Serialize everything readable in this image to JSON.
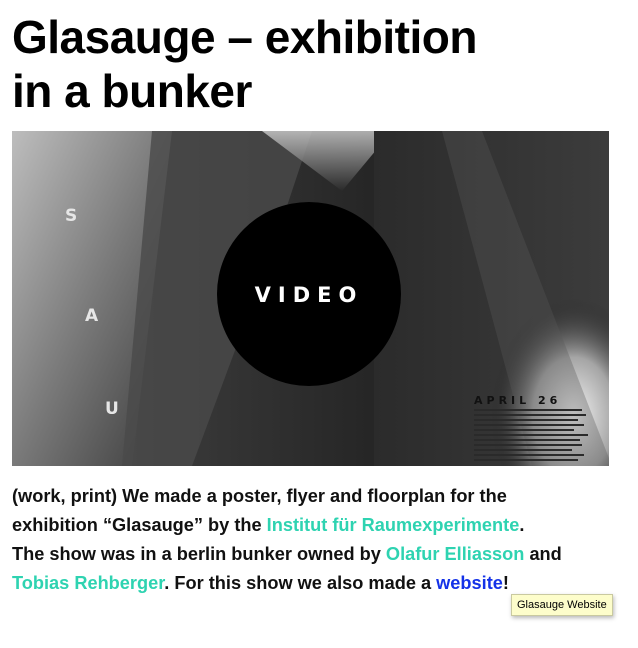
{
  "article": {
    "title_line1": "Glasauge – exhibition",
    "title_line2": "in a bunker"
  },
  "video": {
    "play_label": "VIDEO",
    "letters": [
      "S",
      "A",
      "U"
    ],
    "poster_date": "APRIL 26"
  },
  "description": {
    "part1": "(work, print) We made a poster, flyer and floorplan for the",
    "part2": "exhibition “Glasauge” by the ",
    "link_institute": "Institut für Raumexperimente",
    "part3": ".",
    "part4": "The show was in a berlin bunker owned by ",
    "link_olafur": "Olafur Elliasson",
    "part5": " and",
    "link_tobias": "Tobias Rehberger",
    "part6": ". For this show we also made a ",
    "link_website": "website",
    "part7": "!"
  },
  "tooltip": {
    "text": "Glasauge Website"
  },
  "colors": {
    "link_teal": "#2ed3b1",
    "link_blue": "#1432e8",
    "tooltip_bg": "#fdfdcb"
  }
}
